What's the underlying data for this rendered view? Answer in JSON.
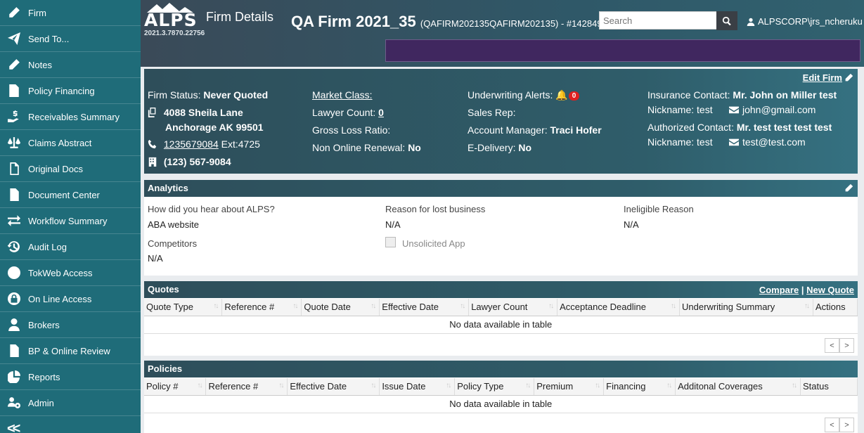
{
  "sidebar": {
    "items": [
      {
        "label": "Firm",
        "icon": "pencil-icon"
      },
      {
        "label": "Send To...",
        "icon": "paper-plane-icon"
      },
      {
        "label": "Notes",
        "icon": "pencil-icon"
      },
      {
        "label": "Policy Financing",
        "icon": "invoice-dollar-icon"
      },
      {
        "label": "Receivables Summary",
        "icon": "hand-holding-dollar-icon"
      },
      {
        "label": "Claims Abstract",
        "icon": "balance-scale-icon"
      },
      {
        "label": "Original Docs",
        "icon": "file-icon"
      },
      {
        "label": "Document Center",
        "icon": "file-lines-icon"
      },
      {
        "label": "Workflow Summary",
        "icon": "exchange-arrows-icon"
      },
      {
        "label": "Audit Log",
        "icon": "history-icon"
      },
      {
        "label": "TokWeb Access",
        "icon": "globe-icon"
      },
      {
        "label": "On Line Access",
        "icon": "lock-icon"
      },
      {
        "label": "Brokers",
        "icon": "user-tie-icon"
      },
      {
        "label": "BP & Online Review",
        "icon": "file-invoice-icon"
      },
      {
        "label": "Reports",
        "icon": "pie-chart-icon"
      },
      {
        "label": "Admin",
        "icon": "users-cog-icon"
      }
    ],
    "collapse_label": "<<"
  },
  "header": {
    "logo_text": "ALPS",
    "version": "2021.3.7870.22756",
    "subtitle": "Firm Details",
    "firm_name": "QA Firm 2021_35",
    "firm_codes": "(QAFIRM202135QAFIRM202135) - #142849",
    "search_placeholder": "Search",
    "user": "ALPSCORP\\jrs_ncheruku"
  },
  "firm": {
    "edit_label": "Edit Firm",
    "status_label": "Firm Status:",
    "status_value": "Never Quoted",
    "address_line1": "4088 Sheila Lane",
    "address_line2": "Anchorage AK 99501",
    "phone": "1235679084",
    "ext": "Ext:4725",
    "fax": "(123) 567-9084",
    "market_class_label": "Market Class:",
    "lawyer_count_label": "Lawyer Count:",
    "lawyer_count_value": "0",
    "gross_loss_label": "Gross Loss Ratio:",
    "non_online_label": "Non Online Renewal:",
    "non_online_value": "No",
    "uw_alerts_label": "Underwriting Alerts:",
    "uw_alerts_count": "0",
    "sales_rep_label": "Sales Rep:",
    "account_manager_label": "Account Manager:",
    "account_manager_value": "Traci Hofer",
    "edelivery_label": "E-Delivery:",
    "edelivery_value": "No",
    "insurance_contact_label": "Insurance Contact:",
    "insurance_contact_value": "Mr. John on Miller test",
    "ins_nickname": "Nickname: test",
    "ins_email": "john@gmail.com",
    "authorized_contact_label": "Authorized Contact:",
    "authorized_contact_value": "Mr. test test test test",
    "auth_nickname": "Nickname: test",
    "auth_email": "test@test.com"
  },
  "analytics": {
    "title": "Analytics",
    "hear_label": "How did you hear about ALPS?",
    "hear_value": "ABA website",
    "lost_label": "Reason for lost business",
    "lost_value": "N/A",
    "ineligible_label": "Ineligible Reason",
    "ineligible_value": "N/A",
    "competitors_label": "Competitors",
    "competitors_value": "N/A",
    "unsolicited_label": "Unsolicited App",
    "unsolicited_checked": false
  },
  "quotes": {
    "title": "Quotes",
    "compare_label": "Compare",
    "separator": "|",
    "new_quote_label": "New Quote",
    "columns": [
      "Quote Type",
      "Reference #",
      "Quote Date",
      "Effective Date",
      "Lawyer Count",
      "Acceptance Deadline",
      "Underwriting Summary",
      "Actions"
    ],
    "empty_text": "No data available in table"
  },
  "policies": {
    "title": "Policies",
    "columns": [
      "Policy #",
      "Reference #",
      "Effective Date",
      "Issue Date",
      "Policy Type",
      "Premium",
      "Financing",
      "Additonal Coverages",
      "Status"
    ],
    "empty_text": "No data available in table"
  },
  "pager": {
    "prev": "<",
    "next": ">"
  },
  "colors": {
    "sidebar": "#1f6c79",
    "header": "#2f5868",
    "purple_bar": "#40275f",
    "alert_badge": "#e02020"
  }
}
